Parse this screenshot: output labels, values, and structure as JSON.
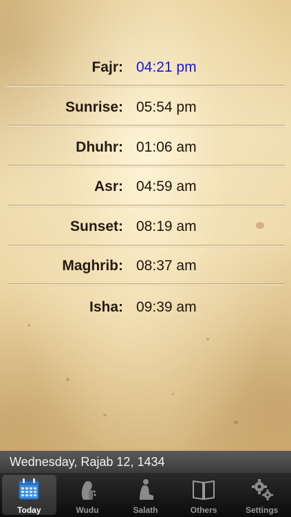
{
  "prayer_times": [
    {
      "name": "Fajr:",
      "time": "04:21 pm"
    },
    {
      "name": "Sunrise:",
      "time": "05:54 pm"
    },
    {
      "name": "Dhuhr:",
      "time": "01:06 am"
    },
    {
      "name": "Asr:",
      "time": "04:59 am"
    },
    {
      "name": "Sunset:",
      "time": "08:19 am"
    },
    {
      "name": "Maghrib:",
      "time": "08:37 am"
    },
    {
      "name": "Isha:",
      "time": "09:39 am"
    }
  ],
  "date_text": "Wednesday, Rajab 12, 1434",
  "tabs": [
    {
      "label": "Today",
      "icon": "calendar-icon",
      "selected": true
    },
    {
      "label": "Wudu",
      "icon": "wudu-icon",
      "selected": false
    },
    {
      "label": "Salath",
      "icon": "prayer-person-icon",
      "selected": false
    },
    {
      "label": "Others",
      "icon": "book-icon",
      "selected": false
    },
    {
      "label": "Settings",
      "icon": "gears-icon",
      "selected": false
    }
  ],
  "colors": {
    "highlight_time": "#1515e6",
    "accent_calendar": "#3d8fe0"
  }
}
